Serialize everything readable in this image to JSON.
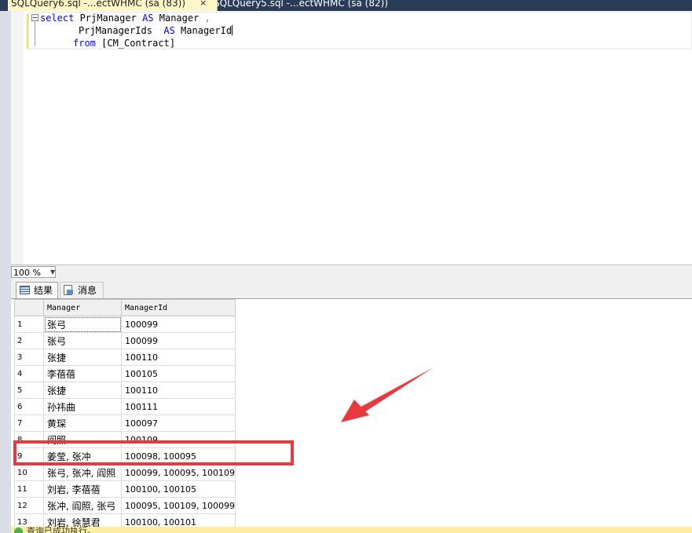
{
  "window": {
    "tabs": [
      {
        "label": "SQLQuery6.sql -...ectWHMC (sa (83))",
        "active": true
      },
      {
        "label": "SQLQuery5.sql -...ectWHMC (sa (82))",
        "active": false
      }
    ],
    "close_glyph": "×"
  },
  "editor": {
    "line1": {
      "kw1": "select",
      "t1": " PrjManager ",
      "kw2": "AS",
      "t2": " Manager ",
      "t3": ","
    },
    "line2": {
      "t1": "PrjManagerIds  ",
      "kw1": "AS",
      "t2": " ManagerId"
    },
    "line3": {
      "kw1": "from",
      "t1": " [CM_Contract]"
    }
  },
  "zoom": {
    "value": "100 %",
    "arrow": "▼"
  },
  "results_tabs": [
    {
      "label": "结果",
      "icon": "grid-icon",
      "active": true
    },
    {
      "label": "消息",
      "icon": "message-icon",
      "active": false
    }
  ],
  "grid": {
    "columns": [
      "Manager",
      "ManagerId"
    ],
    "rows": [
      {
        "n": "1",
        "manager": "张弓",
        "id": "100099"
      },
      {
        "n": "2",
        "manager": "张弓",
        "id": "100099"
      },
      {
        "n": "3",
        "manager": "张捷",
        "id": "100110"
      },
      {
        "n": "4",
        "manager": "李蓓蓓",
        "id": "100105"
      },
      {
        "n": "5",
        "manager": "张捷",
        "id": "100110"
      },
      {
        "n": "6",
        "manager": "孙祎曲",
        "id": "100111"
      },
      {
        "n": "7",
        "manager": "黄琛",
        "id": "100097"
      },
      {
        "n": "8",
        "manager": "阎照",
        "id": "100109"
      },
      {
        "n": "9",
        "manager": "姜莹, 张冲",
        "id": "100098, 100095"
      },
      {
        "n": "10",
        "manager": "张弓, 张冲, 阎照",
        "id": "100099, 100095, 100109"
      },
      {
        "n": "11",
        "manager": "刘岩, 李蓓蓓",
        "id": "100100, 100105"
      },
      {
        "n": "12",
        "manager": "张冲, 阎照, 张弓",
        "id": "100095, 100109, 100099"
      },
      {
        "n": "13",
        "manager": "刘岩, 徐慧君",
        "id": "100100, 100101"
      }
    ]
  },
  "status": {
    "text": "查询已成功执行。"
  },
  "colors": {
    "highlight": "#e8393c",
    "keyword": "#0000ff",
    "status_bg": "#fbeea0"
  }
}
